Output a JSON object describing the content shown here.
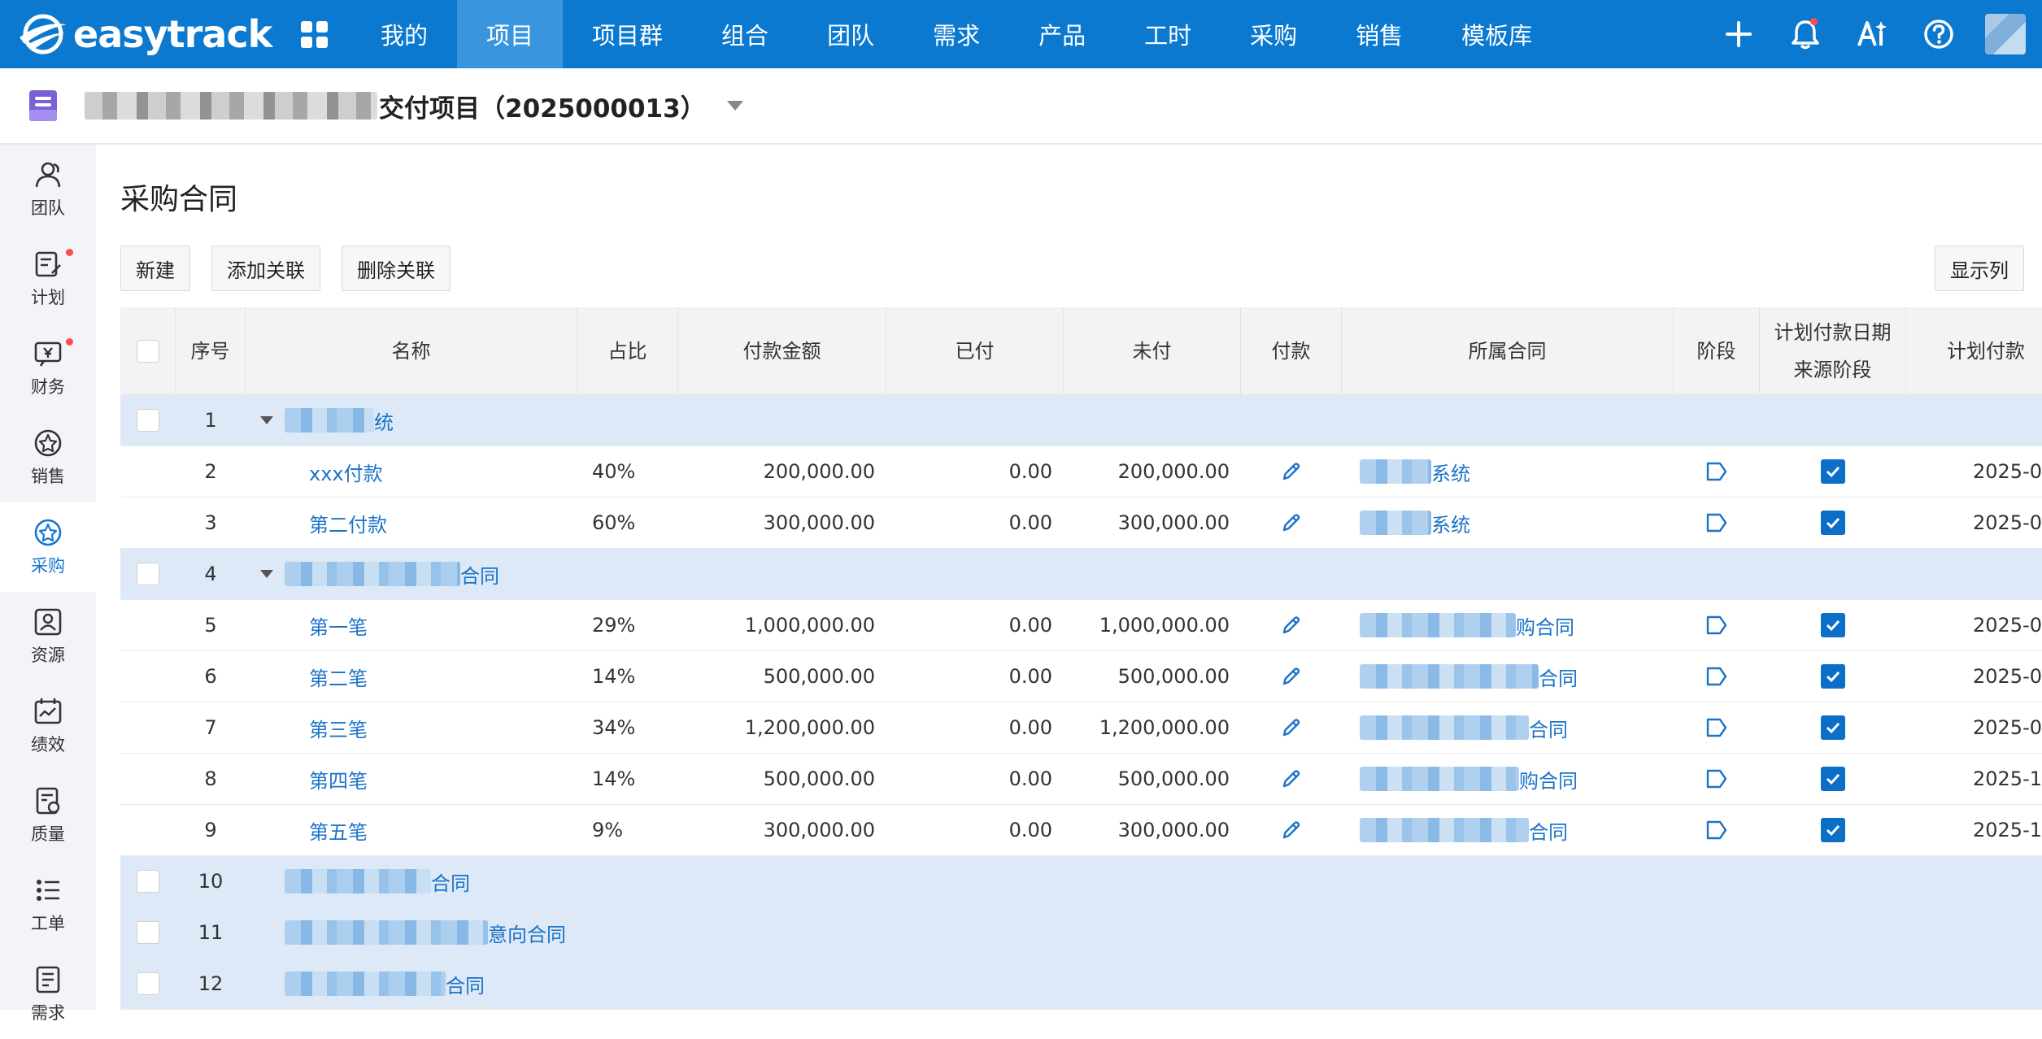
{
  "nav": {
    "logo_text": "easytrack",
    "items": [
      {
        "label": "我的",
        "active": false
      },
      {
        "label": "项目",
        "active": true
      },
      {
        "label": "项目群",
        "active": false
      },
      {
        "label": "组合",
        "active": false
      },
      {
        "label": "团队",
        "active": false
      },
      {
        "label": "需求",
        "active": false
      },
      {
        "label": "产品",
        "active": false
      },
      {
        "label": "工时",
        "active": false
      },
      {
        "label": "采购",
        "active": false
      },
      {
        "label": "销售",
        "active": false
      },
      {
        "label": "模板库",
        "active": false
      }
    ],
    "right_icons": [
      "plus-icon",
      "bell-icon",
      "ai-icon",
      "help-icon",
      "avatar"
    ]
  },
  "project": {
    "title_visible": "交付项目（2025000013）"
  },
  "sidebar": {
    "items": [
      {
        "label": "团队",
        "icon": "team-icon",
        "dot": false,
        "active": false
      },
      {
        "label": "计划",
        "icon": "plan-icon",
        "dot": true,
        "active": false
      },
      {
        "label": "财务",
        "icon": "finance-icon",
        "dot": true,
        "active": false
      },
      {
        "label": "销售",
        "icon": "sales-icon",
        "dot": false,
        "active": false
      },
      {
        "label": "采购",
        "icon": "purchase-icon",
        "dot": false,
        "active": true
      },
      {
        "label": "资源",
        "icon": "resource-icon",
        "dot": false,
        "active": false
      },
      {
        "label": "绩效",
        "icon": "performance-icon",
        "dot": false,
        "active": false
      },
      {
        "label": "质量",
        "icon": "quality-icon",
        "dot": false,
        "active": false
      },
      {
        "label": "工单",
        "icon": "workorder-icon",
        "dot": false,
        "active": false
      },
      {
        "label": "需求",
        "icon": "requirement-icon",
        "dot": false,
        "active": false
      }
    ]
  },
  "page": {
    "title": "采购合同",
    "toolbar": {
      "new": "新建",
      "add_link": "添加关联",
      "remove_link": "删除关联",
      "columns": "显示列"
    }
  },
  "table": {
    "headers": {
      "no": "序号",
      "name": "名称",
      "pct": "占比",
      "amount": "付款金额",
      "paid": "已付",
      "unpaid": "未付",
      "pay": "付款",
      "contract": "所属合同",
      "stage": "阶段",
      "src_line1": "计划付款日期",
      "src_line2": "来源阶段",
      "date": "计划付款"
    },
    "rows": [
      {
        "type": "group",
        "no": "1",
        "name_suffix": "统"
      },
      {
        "type": "item",
        "no": "2",
        "name": "xxx付款",
        "pct": "40%",
        "amount": "200,000.00",
        "paid": "0.00",
        "unpaid": "200,000.00",
        "contract_suffix": "系统",
        "date": "2025-0"
      },
      {
        "type": "item",
        "no": "3",
        "name": "第二付款",
        "pct": "60%",
        "amount": "300,000.00",
        "paid": "0.00",
        "unpaid": "300,000.00",
        "contract_suffix": "系统",
        "date": "2025-0"
      },
      {
        "type": "group",
        "no": "4",
        "name_suffix": "合同"
      },
      {
        "type": "item",
        "no": "5",
        "name": "第一笔",
        "pct": "29%",
        "amount": "1,000,000.00",
        "paid": "0.00",
        "unpaid": "1,000,000.00",
        "contract_suffix": "购合同",
        "date": "2025-0"
      },
      {
        "type": "item",
        "no": "6",
        "name": "第二笔",
        "pct": "14%",
        "amount": "500,000.00",
        "paid": "0.00",
        "unpaid": "500,000.00",
        "contract_suffix": "合同",
        "date": "2025-0"
      },
      {
        "type": "item",
        "no": "7",
        "name": "第三笔",
        "pct": "34%",
        "amount": "1,200,000.00",
        "paid": "0.00",
        "unpaid": "1,200,000.00",
        "contract_suffix": "合同",
        "date": "2025-0"
      },
      {
        "type": "item",
        "no": "8",
        "name": "第四笔",
        "pct": "14%",
        "amount": "500,000.00",
        "paid": "0.00",
        "unpaid": "500,000.00",
        "contract_suffix": "购合同",
        "date": "2025-1"
      },
      {
        "type": "item",
        "no": "9",
        "name": "第五笔",
        "pct": "9%",
        "amount": "300,000.00",
        "paid": "0.00",
        "unpaid": "300,000.00",
        "contract_suffix": "合同",
        "date": "2025-1"
      },
      {
        "type": "group",
        "no": "10",
        "name_suffix": "合同"
      },
      {
        "type": "group",
        "no": "11",
        "name_suffix": "意向合同"
      },
      {
        "type": "group",
        "no": "12",
        "name_suffix": "合同"
      }
    ]
  },
  "colors": {
    "nav_bg": "#0b79d0",
    "nav_active": "#3895de",
    "link": "#1c73c8",
    "group_row": "#dde9f6",
    "checkbox_on": "#0b6ec8"
  }
}
